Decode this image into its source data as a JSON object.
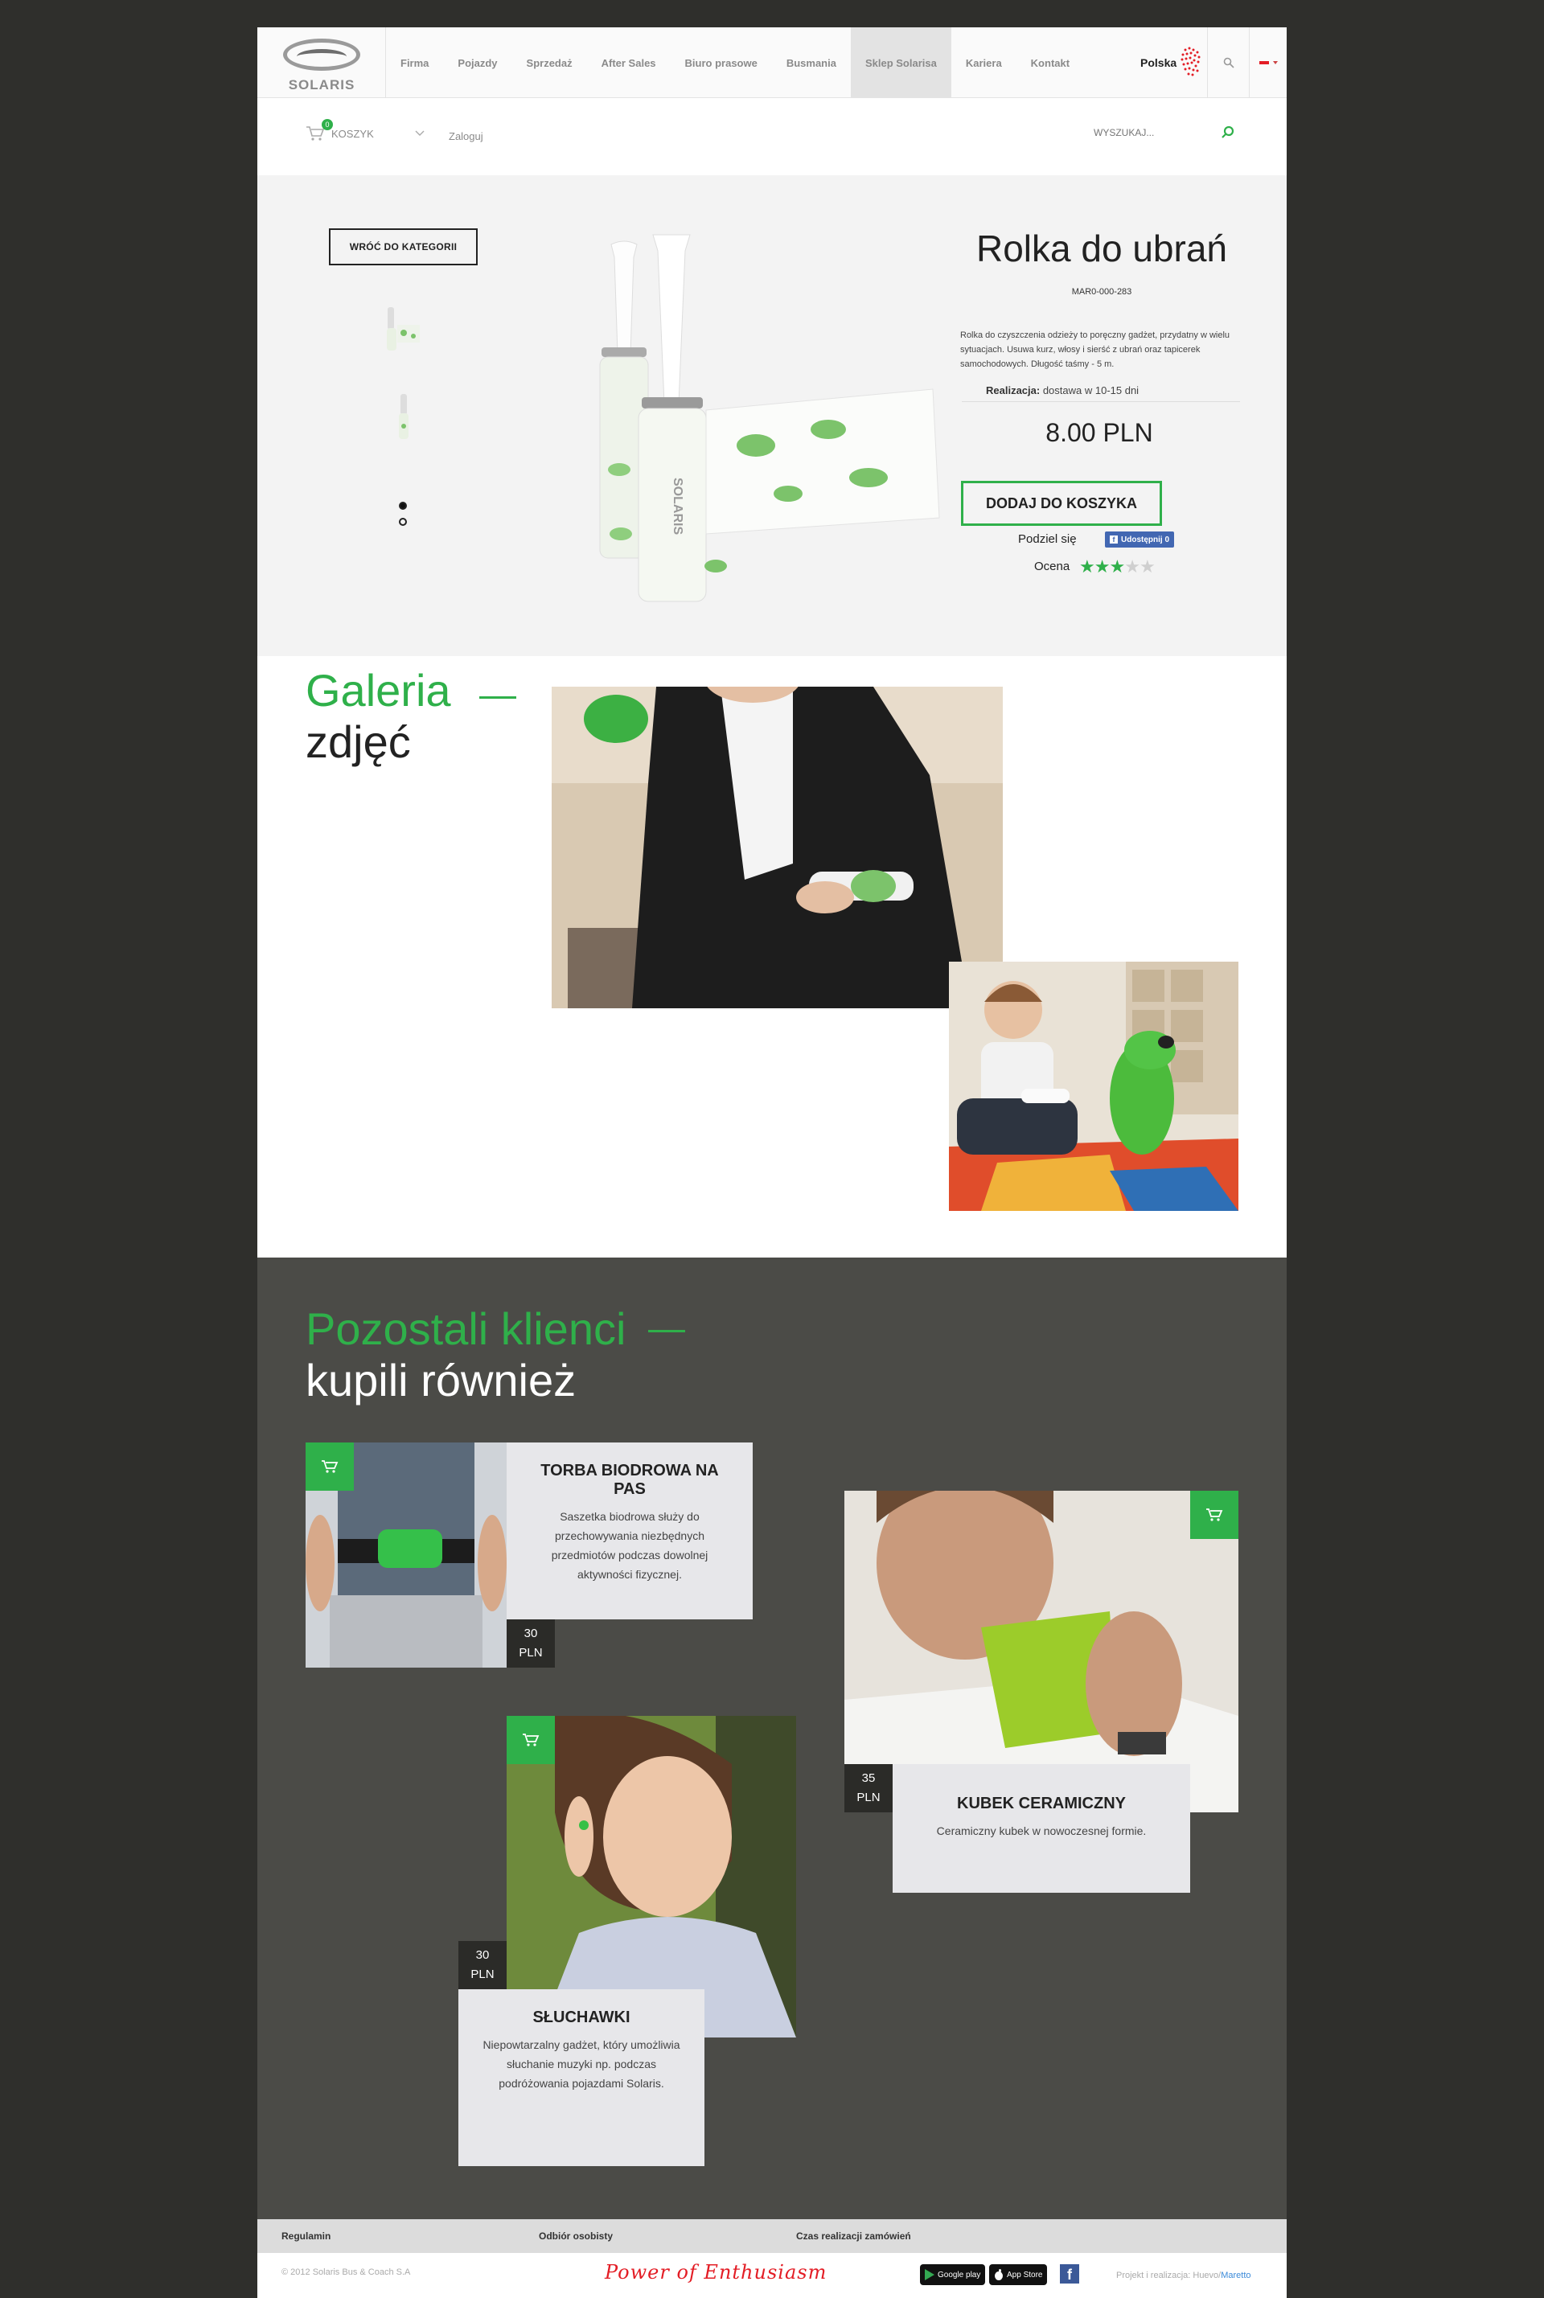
{
  "header": {
    "logo_text": "SOLARIS",
    "nav": [
      "Firma",
      "Pojazdy",
      "Sprzedaż",
      "After Sales",
      "Biuro prasowe",
      "Busmania",
      "Sklep Solarisa",
      "Kariera",
      "Kontakt"
    ],
    "active_nav": "Sklep Solarisa",
    "country": "Polska"
  },
  "subbar": {
    "cart_count": "0",
    "cart_label": "KOSZYK",
    "login": "Zaloguj",
    "search_placeholder": "WYSZUKAJ..."
  },
  "product": {
    "back": "WRÓĆ DO KATEGORII",
    "title": "Rolka do ubrań",
    "sku": "MAR0-000-283",
    "description": "Rolka do czyszczenia odzieży to poręczny gadżet, przydatny w wielu sytuacjach. Usuwa kurz, włosy i sierść z ubrań oraz tapicerek samochodowych. Długość taśmy - 5 m.",
    "realization_label": "Realizacja:",
    "realization_value": "dostawa w 10-15 dni",
    "price": "8.00 PLN",
    "add_to_cart": "DODAJ DO KOSZYKA",
    "share_label": "Podziel się",
    "share_button": "Udostępnij 0",
    "rating_label": "Ocena",
    "rating": 3,
    "rating_max": 5
  },
  "gallery": {
    "title_1": "Galeria",
    "title_2": "zdjęć"
  },
  "others": {
    "title_1": "Pozostali klienci",
    "title_2": "kupili również",
    "items": [
      {
        "name": "TORBA BIODROWA NA PAS",
        "desc": "Saszetka biodrowa służy do przechowywania niezbędnych przedmiotów podczas dowolnej aktywności fizycznej.",
        "price_num": "30",
        "price_cur": "PLN"
      },
      {
        "name": "KUBEK CERAMICZNY",
        "desc": "Ceramiczny kubek w nowoczesnej formie.",
        "price_num": "35",
        "price_cur": "PLN"
      },
      {
        "name": "SŁUCHAWKI",
        "desc": "Niepowtarzalny gadżet, który umożliwia słuchanie muzyki np. podczas podróżowania pojazdami Solaris.",
        "price_num": "30",
        "price_cur": "PLN"
      }
    ]
  },
  "footer": {
    "links": [
      "Regulamin",
      "Odbiór osobisty",
      "Czas realizacji zamówień"
    ],
    "copyright": "© 2012 Solaris Bus & Coach S.A",
    "slogan": "Power of Enthusiasm",
    "google_play": "Google play",
    "app_store": "App Store",
    "credit_prefix": "Projekt i realizacja: Huevo/",
    "credit_link": "Maretto"
  },
  "colors": {
    "accent": "#2fb04a",
    "dark_bg": "#4b4b47",
    "outer_bg": "#2f2f2c",
    "product_bg": "#f3f3f3"
  }
}
